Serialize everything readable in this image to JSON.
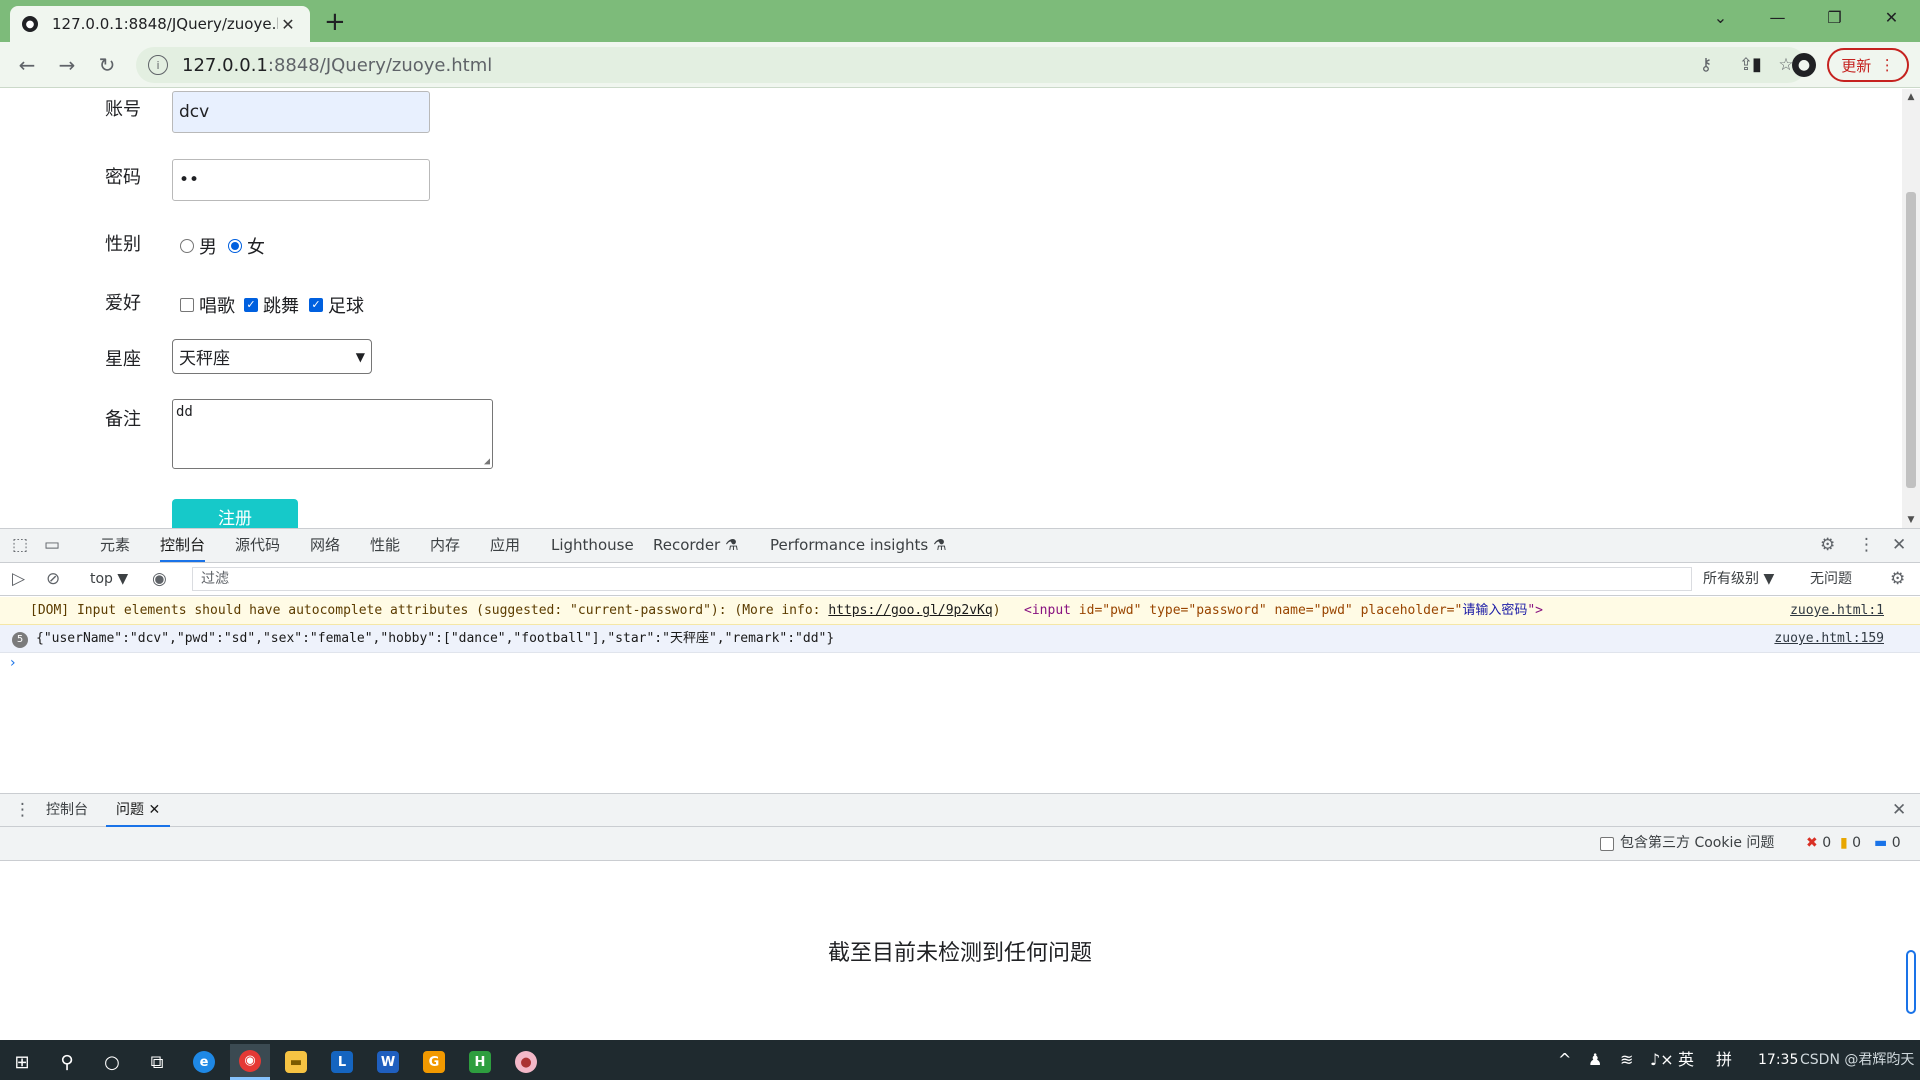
{
  "browser": {
    "tab_title": "127.0.0.1:8848/JQuery/zuoye.h",
    "url_host": "127.0.0.1",
    "url_rest": ":8848/JQuery/zuoye.html",
    "update_label": "更新",
    "accent": "#7dbb7a"
  },
  "form": {
    "account_label": "账号",
    "account_value": "dcv",
    "password_label": "密码",
    "password_value": "••",
    "gender_label": "性别",
    "gender_options": [
      "男",
      "女"
    ],
    "gender_selected": "女",
    "hobby_label": "爱好",
    "hobby_options": [
      "唱歌",
      "跳舞",
      "足球"
    ],
    "hobby_checked": [
      "跳舞",
      "足球"
    ],
    "star_label": "星座",
    "star_value": "天秤座",
    "remark_label": "备注",
    "remark_value": "dd",
    "submit_label": "注册"
  },
  "devtools": {
    "tabs": [
      "元素",
      "控制台",
      "源代码",
      "网络",
      "性能",
      "内存",
      "应用",
      "Lighthouse",
      "Recorder",
      "Performance insights"
    ],
    "active_tab": "控制台",
    "context": "top",
    "filter_placeholder": "过滤",
    "levels": "所有级别",
    "no_issues": "无问题",
    "warning": {
      "text": "[DOM] Input elements should have autocomplete attributes (suggested: \"current-password\"): (More info: ",
      "link": "https://goo.gl/9p2vKq",
      "close": ")",
      "element_open": "<input",
      "attrs": " id=\"pwd\" type=\"password\" name=\"pwd\" placeholder=\"",
      "placeholder_value": "请输入密码",
      "element_close": "\">",
      "source": "zuoye.html:1"
    },
    "log": {
      "count": "5",
      "text": "{\"userName\":\"dcv\",\"pwd\":\"sd\",\"sex\":\"female\",\"hobby\":[\"dance\",\"football\"],\"star\":\"天秤座\",\"remark\":\"dd\"}",
      "source": "zuoye.html:159"
    },
    "prompt": "›",
    "drawer": {
      "tabs": [
        "控制台",
        "问题"
      ],
      "active_tab": "问题",
      "third_party_label": "包含第三方 Cookie 问题",
      "error_count": "0",
      "warning_count": "0",
      "info_count": "0",
      "empty_message": "截至目前未检测到任何问题"
    }
  },
  "taskbar": {
    "ime": "英",
    "time": "17:35",
    "watermark": "CSDN @君辉昀天"
  }
}
